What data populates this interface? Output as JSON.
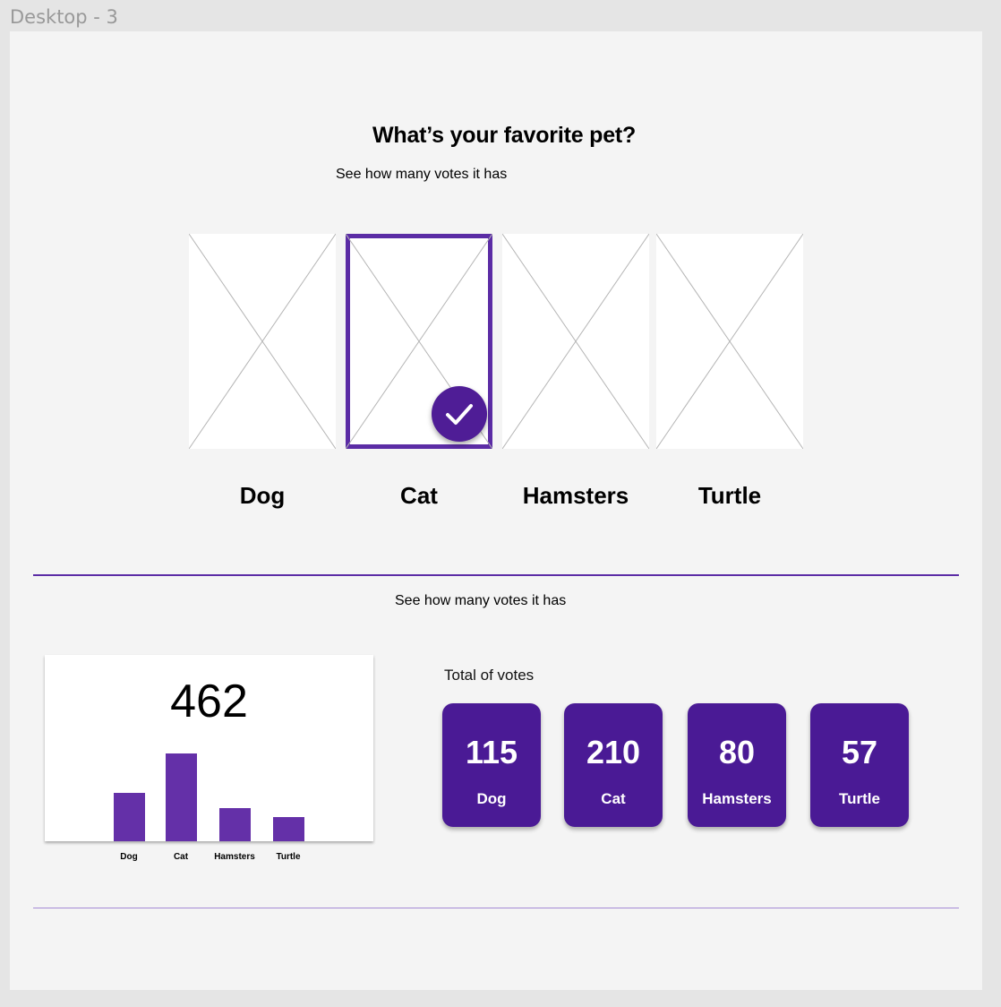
{
  "frame": {
    "label": "Desktop - 3"
  },
  "header": {
    "title": "What’s your favorite pet?",
    "subtitle": "See how many votes it has"
  },
  "pets": [
    {
      "label": "Dog",
      "selected": false
    },
    {
      "label": "Cat",
      "selected": true
    },
    {
      "label": "Hamsters",
      "selected": false
    },
    {
      "label": "Turtle",
      "selected": false
    }
  ],
  "results": {
    "subtitle": "See how many votes it has",
    "total": "462",
    "total_label": "Total of votes",
    "tiles": [
      {
        "count": "115",
        "name": "Dog"
      },
      {
        "count": "210",
        "name": "Cat"
      },
      {
        "count": "80",
        "name": "Hamsters"
      },
      {
        "count": "57",
        "name": "Turtle"
      }
    ]
  },
  "chart_data": {
    "type": "bar",
    "categories": [
      "Dog",
      "Cat",
      "Hamsters",
      "Turtle"
    ],
    "values": [
      115,
      210,
      80,
      57
    ],
    "title": "462",
    "xlabel": "",
    "ylabel": "",
    "grid": false
  },
  "colors": {
    "accent": "#5b2ca5",
    "tile": "#4a1a95",
    "bar": "#6430a8",
    "divider_top": "#5b2ca5",
    "divider_bottom": "#a48ad6"
  }
}
